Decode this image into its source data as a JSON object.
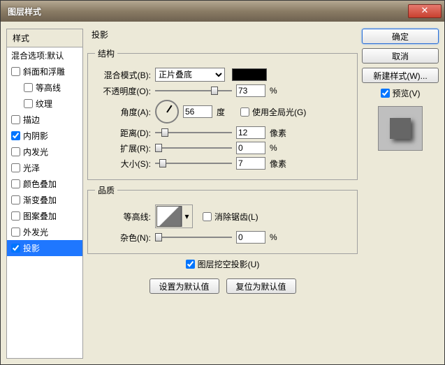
{
  "window": {
    "title": "图层样式"
  },
  "left": {
    "header": "样式",
    "blending": "混合选项:默认",
    "items": [
      {
        "label": "斜面和浮雕",
        "checked": false,
        "indent": false
      },
      {
        "label": "等高线",
        "checked": false,
        "indent": true
      },
      {
        "label": "纹理",
        "checked": false,
        "indent": true
      },
      {
        "label": "描边",
        "checked": false,
        "indent": false
      },
      {
        "label": "内阴影",
        "checked": true,
        "indent": false
      },
      {
        "label": "内发光",
        "checked": false,
        "indent": false
      },
      {
        "label": "光泽",
        "checked": false,
        "indent": false
      },
      {
        "label": "颜色叠加",
        "checked": false,
        "indent": false
      },
      {
        "label": "渐变叠加",
        "checked": false,
        "indent": false
      },
      {
        "label": "图案叠加",
        "checked": false,
        "indent": false
      },
      {
        "label": "外发光",
        "checked": false,
        "indent": false
      },
      {
        "label": "投影",
        "checked": true,
        "indent": false,
        "selected": true
      }
    ]
  },
  "panel": {
    "title": "投影",
    "structure": {
      "legend": "结构",
      "blend_label": "混合模式(B):",
      "blend_value": "正片叠底",
      "opacity_label": "不透明度(O):",
      "opacity_value": "73",
      "opacity_unit": "%",
      "angle_label": "角度(A):",
      "angle_value": "56",
      "angle_unit": "度",
      "global_label": "使用全局光(G)",
      "distance_label": "距离(D):",
      "distance_value": "12",
      "distance_unit": "像素",
      "spread_label": "扩展(R):",
      "spread_value": "0",
      "spread_unit": "%",
      "size_label": "大小(S):",
      "size_value": "7",
      "size_unit": "像素"
    },
    "quality": {
      "legend": "品质",
      "contour_label": "等高线:",
      "antialias_label": "消除锯齿(L)",
      "noise_label": "杂色(N):",
      "noise_value": "0",
      "noise_unit": "%"
    },
    "knockout_label": "图层挖空投影(U)",
    "default_btn": "设置为默认值",
    "reset_btn": "复位为默认值"
  },
  "right": {
    "ok": "确定",
    "cancel": "取消",
    "newstyle": "新建样式(W)...",
    "preview_label": "预览(V)"
  }
}
